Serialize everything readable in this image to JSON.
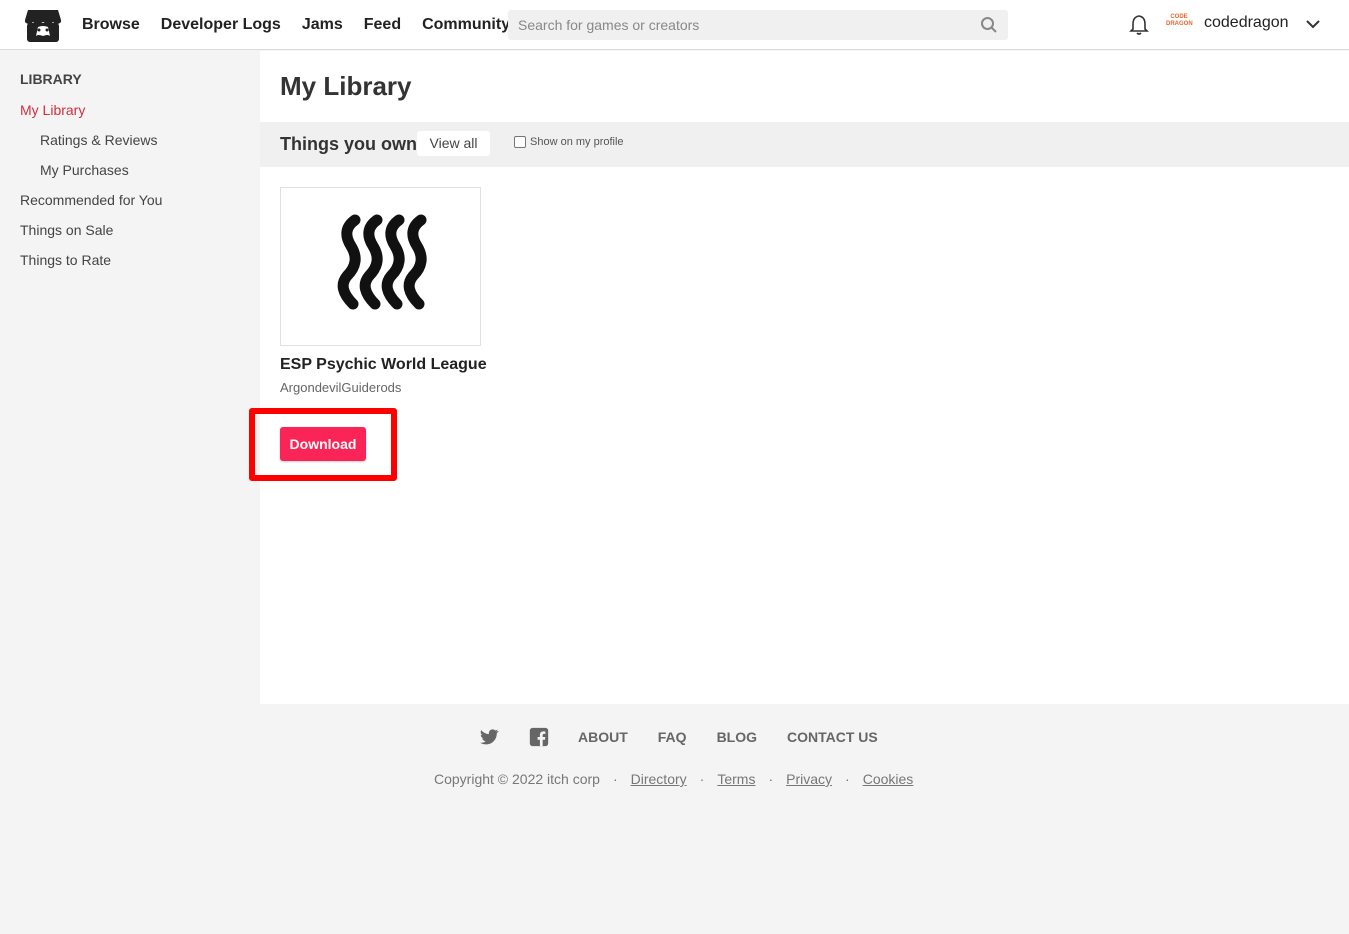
{
  "header": {
    "nav": [
      "Browse",
      "Developer Logs",
      "Jams",
      "Feed",
      "Community"
    ],
    "search_placeholder": "Search for games or creators",
    "username": "codedragon",
    "avatar_text": "CODE DRAGON"
  },
  "sidebar": {
    "heading": "LIBRARY",
    "items": [
      {
        "label": "My Library",
        "active": true
      },
      {
        "label": "Ratings & Reviews"
      },
      {
        "label": "My Purchases"
      },
      {
        "label": "Recommended for You"
      },
      {
        "label": "Things on Sale"
      },
      {
        "label": "Things to Rate"
      }
    ]
  },
  "main": {
    "title": "My Library",
    "section_title": "Things you own",
    "view_all_label": "View all",
    "show_profile_label": "Show on my profile",
    "game": {
      "title": "ESP Psychic World League",
      "author": "ArgondevilGuiderods",
      "download_label": "Download"
    }
  },
  "footer": {
    "links": [
      "ABOUT",
      "FAQ",
      "BLOG",
      "CONTACT US"
    ],
    "copyright": "Copyright © 2022 itch corp",
    "legal": [
      "Directory",
      "Terms",
      "Privacy",
      "Cookies"
    ]
  },
  "colors": {
    "accent": "#fa2556",
    "active_link": "#d1303e",
    "highlight": "#ff0000"
  }
}
